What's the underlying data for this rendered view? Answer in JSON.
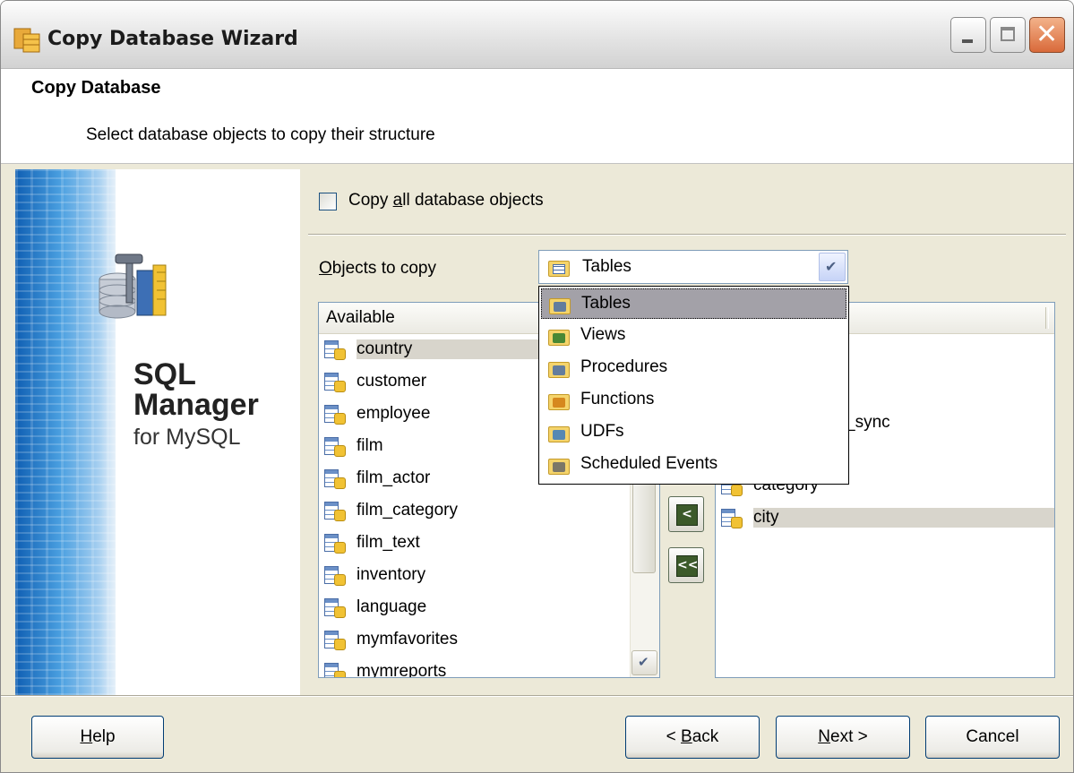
{
  "window": {
    "title": "Copy Database Wizard"
  },
  "header": {
    "title": "Copy Database",
    "subtitle": "Select database objects to copy their structure"
  },
  "sidebar": {
    "product_line1": "SQL",
    "product_line2": "Manager",
    "product_sub": "for MySQL"
  },
  "options": {
    "copy_all_label_pre": "Copy ",
    "copy_all_label_u": "a",
    "copy_all_label_post": "ll database objects",
    "copy_all_checked": false
  },
  "objects": {
    "label_u": "O",
    "label_post": "bjects to copy",
    "selected": "Tables",
    "dropdown_items": [
      {
        "label": "Tables",
        "icon": "tables-folder-icon"
      },
      {
        "label": "Views",
        "icon": "views-folder-icon"
      },
      {
        "label": "Procedures",
        "icon": "procedures-folder-icon"
      },
      {
        "label": "Functions",
        "icon": "functions-folder-icon"
      },
      {
        "label": "UDFs",
        "icon": "udfs-folder-icon"
      },
      {
        "label": "Scheduled Events",
        "icon": "events-folder-icon"
      }
    ]
  },
  "available": {
    "header": "Available",
    "items": [
      "country",
      "customer",
      "employee",
      "film",
      "film_actor",
      "film_category",
      "film_text",
      "inventory",
      "language",
      "mymfavorites",
      "mymreports"
    ],
    "selected_index": 0
  },
  "selected_list": {
    "visible_fragments": [
      "_sync",
      "category",
      "city"
    ],
    "selected_item": "city"
  },
  "buttons": {
    "help_u": "H",
    "help_post": "elp",
    "back_pre": "< ",
    "back_u": "B",
    "back_post": "ack",
    "next_u": "N",
    "next_post": "ext >",
    "cancel": "Cancel"
  }
}
